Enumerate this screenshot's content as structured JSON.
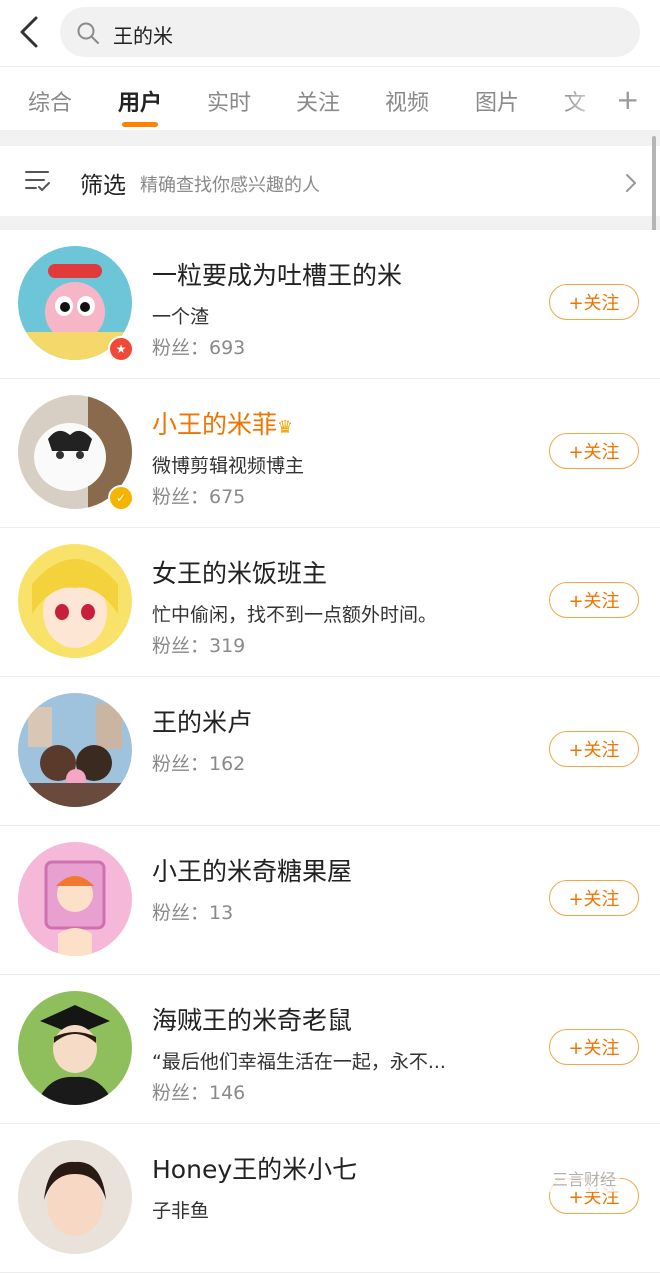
{
  "search": {
    "query": "王的米"
  },
  "tabs": [
    {
      "label": "综合"
    },
    {
      "label": "用户"
    },
    {
      "label": "实时"
    },
    {
      "label": "关注"
    },
    {
      "label": "视频"
    },
    {
      "label": "图片"
    },
    {
      "label": "文"
    }
  ],
  "tab_plus": "+",
  "filter": {
    "title": "筛选",
    "desc": "精确查找你感兴趣的人"
  },
  "users": [
    {
      "name": "一粒要成为吐槽王的米",
      "desc": "一个渣",
      "fans": "粉丝：693",
      "follow": "+关注"
    },
    {
      "name": "小王的米菲",
      "desc": "微博剪辑视频博主",
      "fans": "粉丝：675",
      "follow": "+关注"
    },
    {
      "name": "女王的米饭班主",
      "desc": "忙中偷闲，找不到一点额外时间。",
      "fans": "粉丝：319",
      "follow": "+关注"
    },
    {
      "name": "王的米卢",
      "fans": "粉丝：162",
      "follow": "+关注"
    },
    {
      "name": "小王的米奇糖果屋",
      "fans": "粉丝：13",
      "follow": "+关注"
    },
    {
      "name": "海贼王的米奇老鼠",
      "desc": "“最后他们幸福生活在一起，永不...",
      "fans": "粉丝：146",
      "follow": "+关注"
    },
    {
      "name": "Honey王的米小七",
      "desc": "子非鱼",
      "follow": "+关注"
    }
  ],
  "watermark": "三言财经",
  "colors": {
    "accent": "#ff8200",
    "vip_name": "#f07400",
    "follow_border": "#f3a845"
  },
  "icons": {
    "back": "chevron-left-icon",
    "search": "search-icon",
    "filter": "filter-list-icon",
    "more": "chevron-right-icon"
  }
}
